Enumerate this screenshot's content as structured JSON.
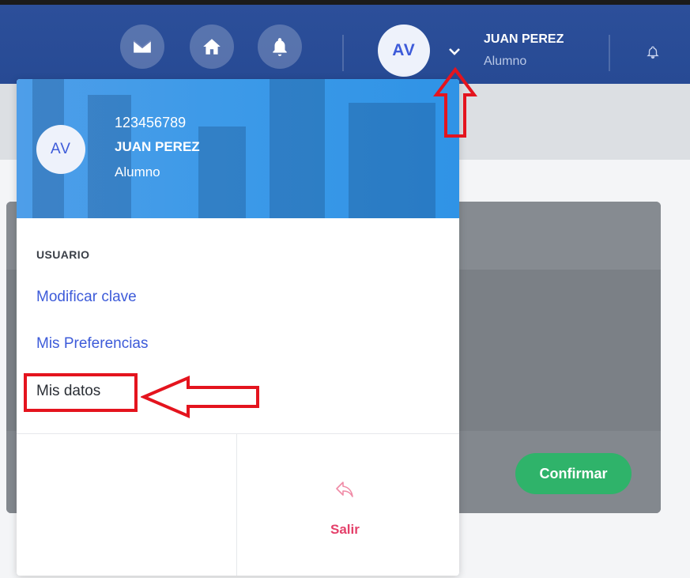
{
  "topbar": {
    "icons": [
      "envelope-icon",
      "home-icon",
      "bell-icon"
    ],
    "avatar_initials": "AV",
    "user_name": "JUAN PEREZ",
    "user_role": "Alumno"
  },
  "dropdown": {
    "avatar_initials": "AV",
    "user_code": "123456789",
    "user_name": "JUAN PEREZ",
    "user_role": "Alumno",
    "section_title": "USUARIO",
    "items": [
      {
        "label": "Modificar clave"
      },
      {
        "label": "Mis Preferencias"
      },
      {
        "label": "Mis datos"
      }
    ],
    "logout_label": "Salir"
  },
  "card": {
    "confirm_label": "Confirmar"
  },
  "colors": {
    "topbar": "#2c4f9a",
    "header_blue": "#3d9ae8",
    "link_blue": "#3d5bd9",
    "confirm_green": "#2fb36a",
    "logout_pink": "#e4406a",
    "annotation_red": "#e4141e"
  }
}
